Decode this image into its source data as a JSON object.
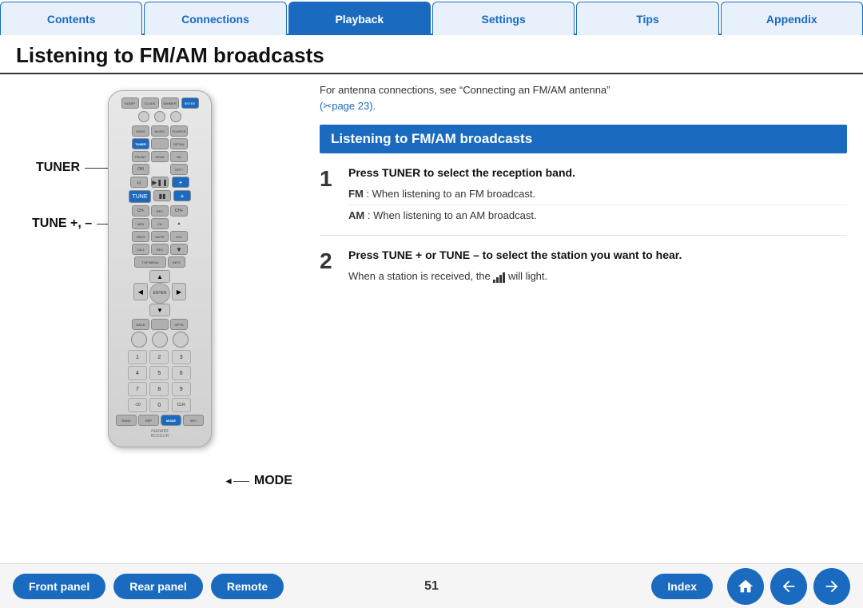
{
  "nav": {
    "tabs": [
      {
        "label": "Contents",
        "active": false
      },
      {
        "label": "Connections",
        "active": false
      },
      {
        "label": "Playback",
        "active": true
      },
      {
        "label": "Settings",
        "active": false
      },
      {
        "label": "Tips",
        "active": false
      },
      {
        "label": "Appendix",
        "active": false
      }
    ]
  },
  "page": {
    "title": "Listening to FM/AM broadcasts",
    "intro_line1": "For antenna connections, see “Connecting an FM/AM antenna”",
    "intro_link": "(✂page 23).",
    "section_header": "Listening to FM/AM broadcasts",
    "steps": [
      {
        "num": "1",
        "title": "Press TUNER to select the reception band.",
        "details": [
          {
            "label": "FM",
            "text": ": When listening to an FM broadcast."
          },
          {
            "label": "AM",
            "text": ": When listening to an AM broadcast."
          }
        ]
      },
      {
        "num": "2",
        "title": "Press TUNE + or TUNE – to select the station you want to hear.",
        "detail_text": "When a station is received, the",
        "detail_suffix": "will light."
      }
    ],
    "page_number": "51"
  },
  "labels": {
    "tuner": "TUNER",
    "tune": "TUNE +, –",
    "mode": "MODE"
  },
  "bottom": {
    "front_panel": "Front panel",
    "rear_panel": "Rear panel",
    "remote": "Remote",
    "index": "Index"
  }
}
